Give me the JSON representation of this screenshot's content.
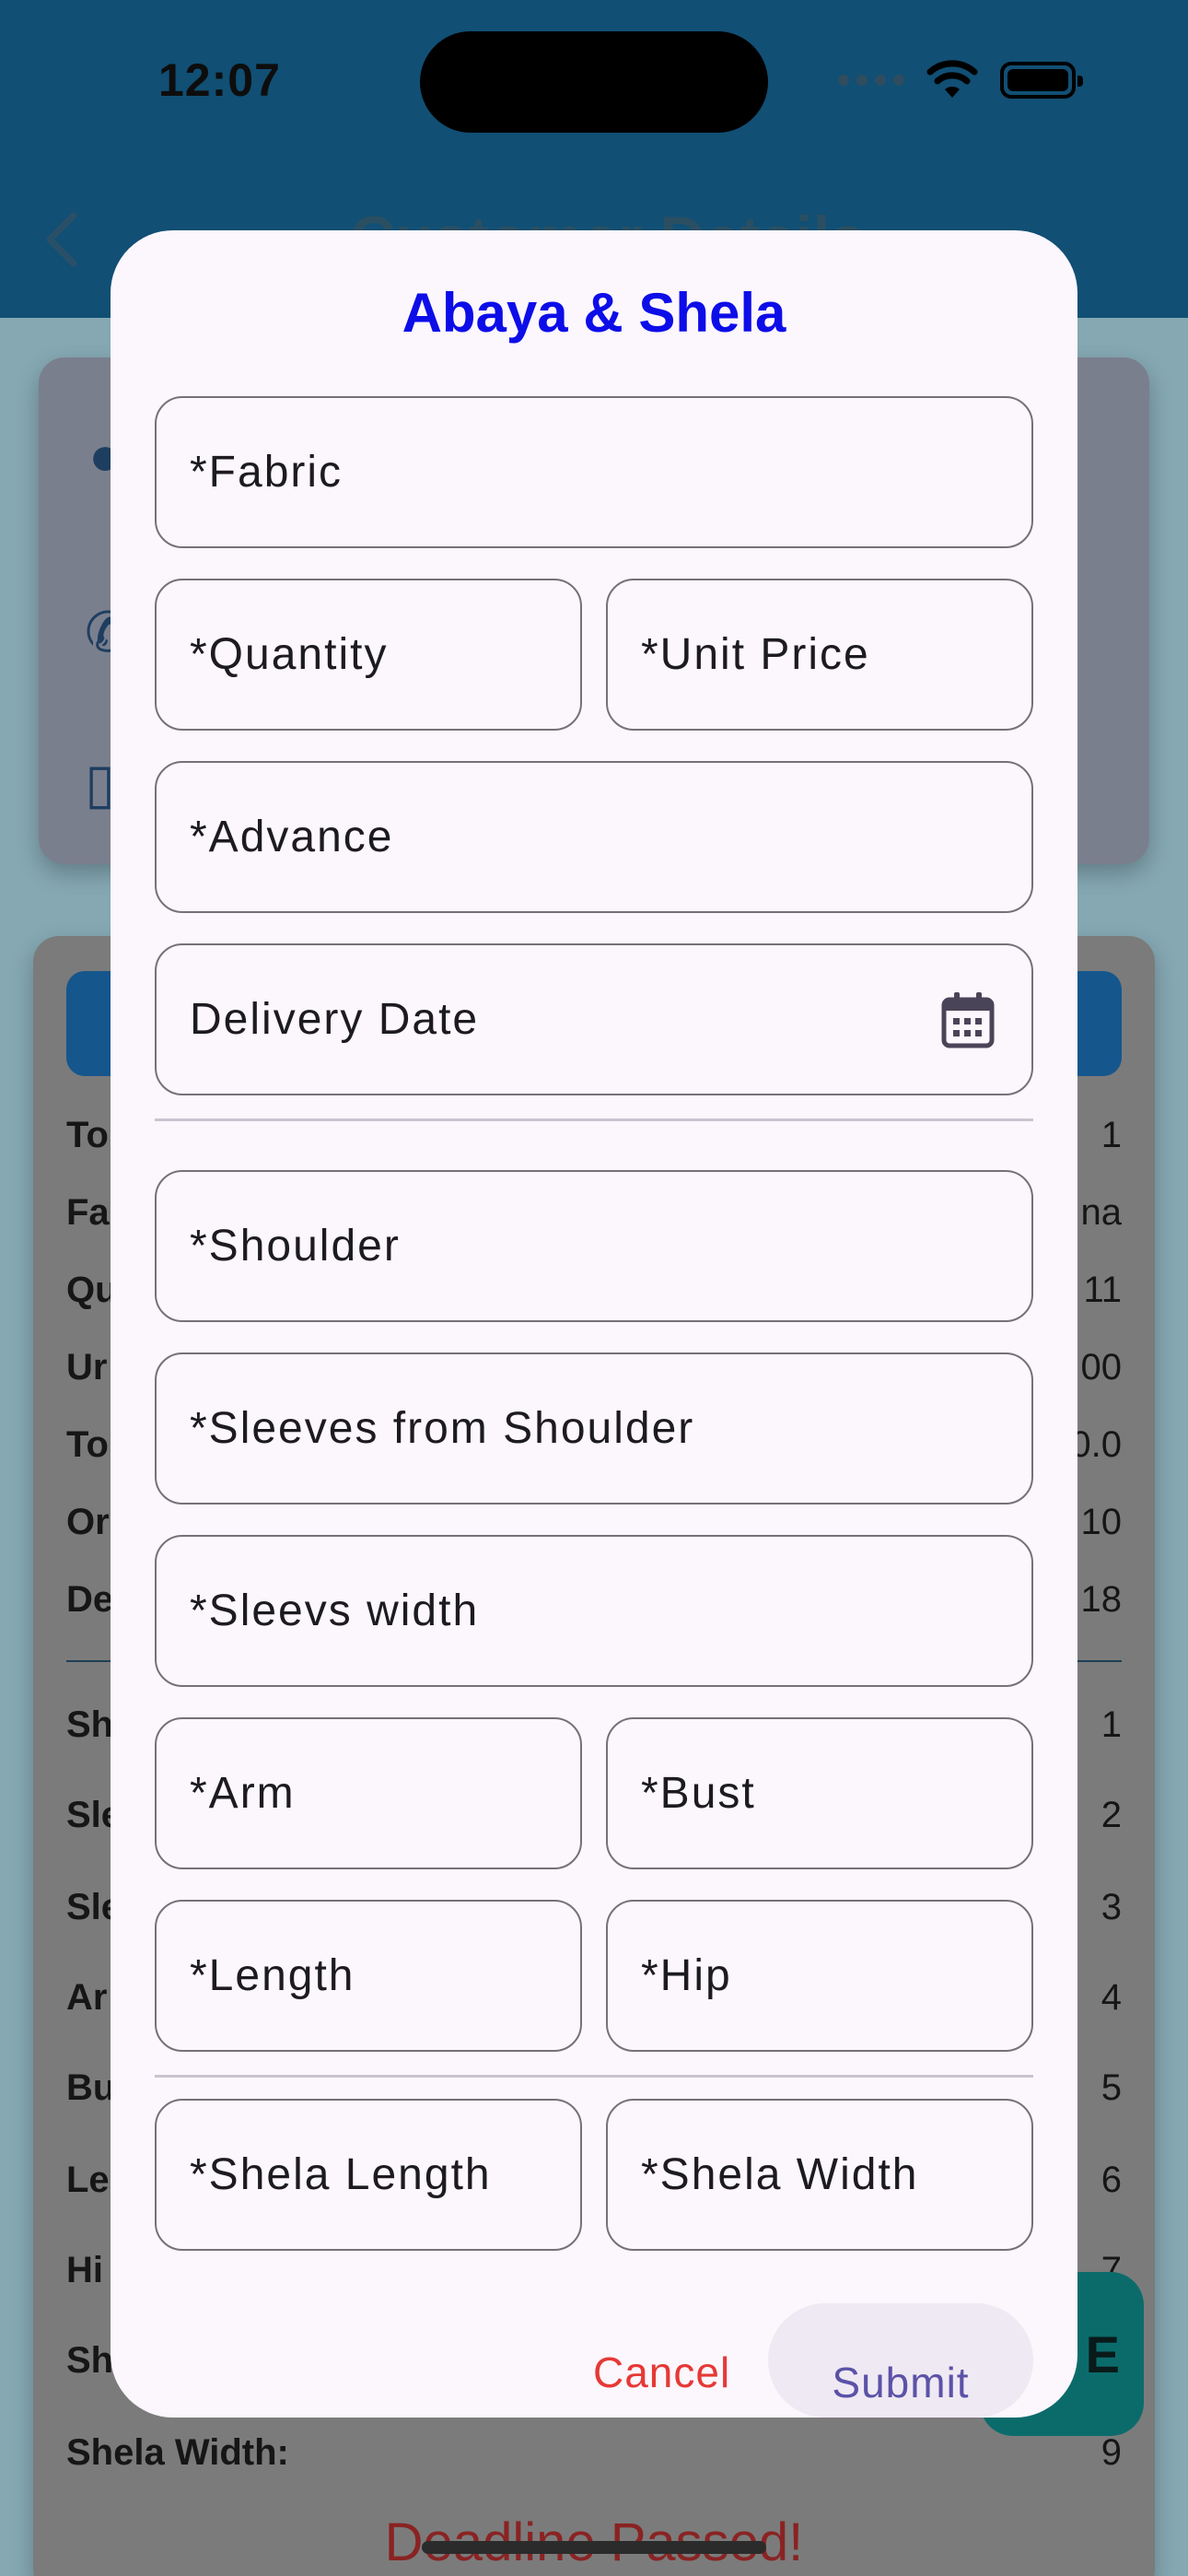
{
  "status_bar": {
    "time": "12:07"
  },
  "appbar": {
    "title": "Customer Details"
  },
  "details": {
    "rows": [
      {
        "label": "To",
        "value": "1"
      },
      {
        "label": "Fa",
        "value": "na"
      },
      {
        "label": "Qu",
        "value": "11"
      },
      {
        "label": "Ur",
        "value": "00"
      },
      {
        "label": "To",
        "value": "0.0"
      },
      {
        "label": "Or",
        "value": "10"
      },
      {
        "label": "De",
        "value": "18"
      }
    ],
    "measurements": [
      {
        "label": "Sh",
        "value": "1"
      },
      {
        "label": "Sle",
        "value": "2"
      },
      {
        "label": "Sle",
        "value": "3"
      },
      {
        "label": "Ar",
        "value": "4"
      },
      {
        "label": "Bu",
        "value": "5"
      },
      {
        "label": "Le",
        "value": "6"
      },
      {
        "label": "Hi",
        "value": "7"
      },
      {
        "label": "Sh",
        "value": ""
      },
      {
        "label": "Shela Width:",
        "value": "9"
      }
    ],
    "deadline_text": "Deadline Passed!",
    "fab_label": "E"
  },
  "dialog": {
    "title": "Abaya & Shela",
    "fields": {
      "fabric": "*Fabric",
      "quantity": "*Quantity",
      "unit_price": "*Unit Price",
      "advance": "*Advance",
      "delivery_date": "Delivery Date",
      "shoulder": "*Shoulder",
      "sleeves_from_shoulder": "*Sleeves from Shoulder",
      "sleeves_width": "*Sleevs width",
      "arm": "*Arm",
      "bust": "*Bust",
      "length": "*Length",
      "hip": "*Hip",
      "shela_length": "*Shela Length",
      "shela_width": "*Shela Width"
    },
    "cancel_label": "Cancel",
    "submit_label": "Submit"
  },
  "colors": {
    "title": "#0d0de8",
    "cancel": "#e53935",
    "submit": "#5b52a8",
    "appbar": "#114f74"
  }
}
